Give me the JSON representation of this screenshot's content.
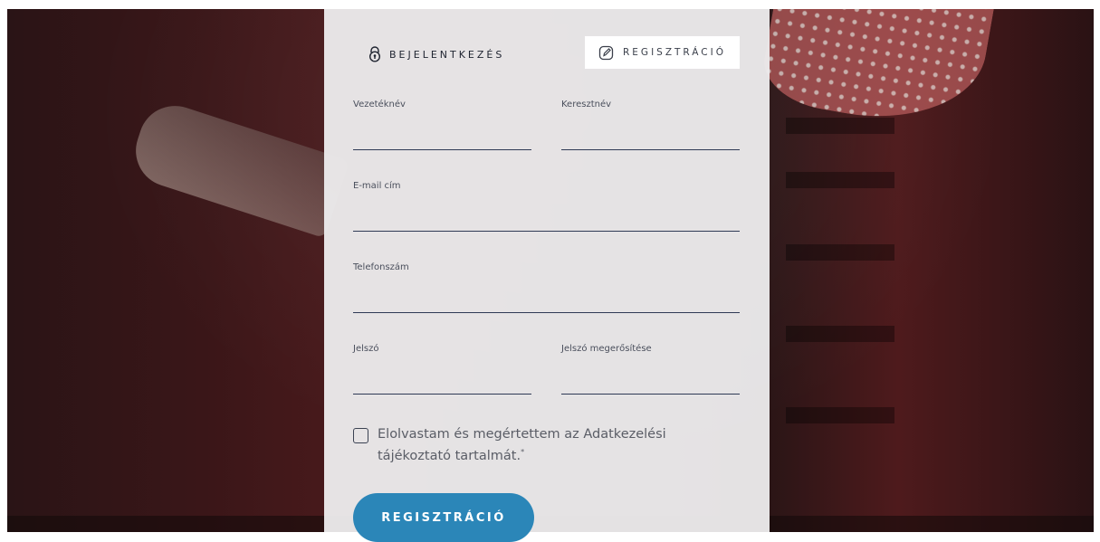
{
  "tabs": {
    "login_label": "BEJELENTKEZÉS",
    "register_label": "REGISZTRÁCIÓ"
  },
  "form": {
    "last_name_label": "Vezetéknév",
    "first_name_label": "Keresztnév",
    "email_label": "E-mail cím",
    "phone_label": "Telefonszám",
    "password_label": "Jelszó",
    "password_confirm_label": "Jelszó megerősítése",
    "last_name_value": "",
    "first_name_value": "",
    "email_value": "",
    "phone_value": "",
    "password_value": "",
    "password_confirm_value": ""
  },
  "consent": {
    "text_line1": "Elolvastam és megértettem az Adatkezelési",
    "text_line2": "tájékoztató tartalmát.",
    "required_mark": "*",
    "checked": false
  },
  "submit_label": "REGISZTRÁCIÓ",
  "colors": {
    "accent": "#2b86b8",
    "panel": "#ecebec",
    "underline": "#2f3a55"
  },
  "icons": {
    "login": "lock-icon",
    "register": "edit-icon"
  }
}
